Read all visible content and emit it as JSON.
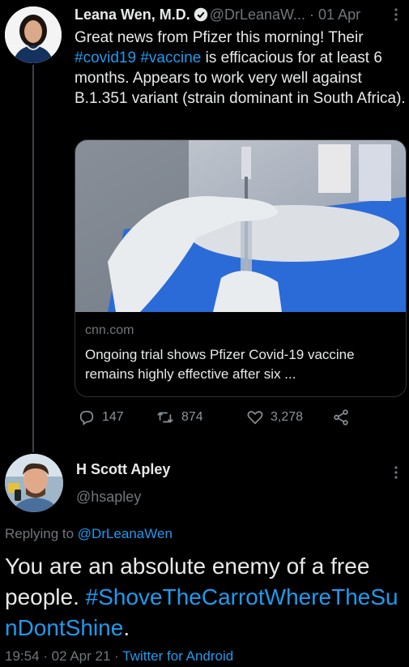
{
  "tweet1": {
    "name": "Leana Wen, M.D.",
    "handle": "@DrLeanaW...",
    "time": "· 01 Apr",
    "text_before": "Great news from Pfizer this morning! Their ",
    "hashtag1": "#covid19",
    "space": " ",
    "hashtag2": "#vaccine",
    "text_after": " is efficacious for at least 6 months. Appears to work very well against B.1.351 variant (strain dominant in South Africa).",
    "card": {
      "domain": "cnn.com",
      "title": "Ongoing trial shows Pfizer Covid-19 vaccine remains highly effective after six ..."
    },
    "actions": {
      "replies": "147",
      "retweets": "874",
      "likes": "3,278"
    }
  },
  "tweet2": {
    "name": "H Scott Apley",
    "handle": "@hsapley",
    "replying_label": "Replying to ",
    "replying_handle": "@DrLeanaWen",
    "text": "You are an absolute enemy of a free people. ",
    "hashtag": "#ShoveTheCarrotWhereTheSunDontShine",
    "text_end": ".",
    "timestamp": "19:54 · 02 Apr 21 · ",
    "source": "Twitter for Android"
  },
  "colors": {
    "background": "#000000",
    "link": "#1d9bf0",
    "muted": "#71767b",
    "text": "#e7e9ea"
  }
}
